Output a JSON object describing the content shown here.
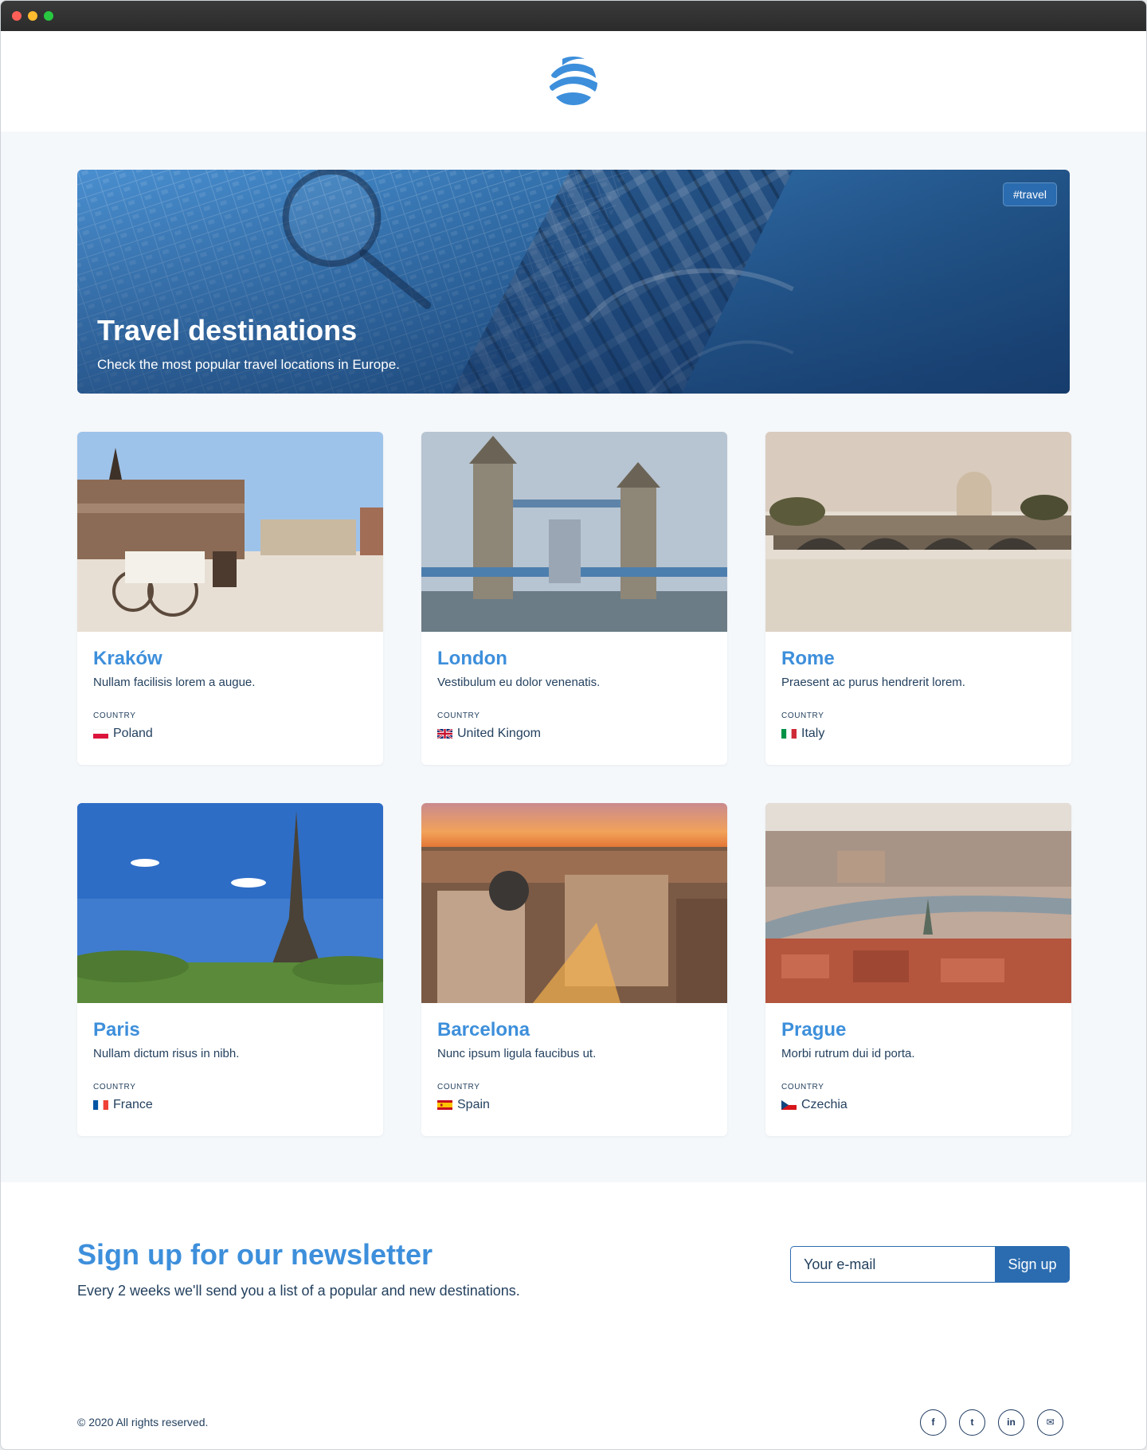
{
  "window": {
    "controls": [
      "close",
      "minimize",
      "maximize"
    ],
    "colors": {
      "close": "#ff5f57",
      "minimize": "#febc2e",
      "maximize": "#28c840"
    }
  },
  "header": {
    "logo_icon": "wave-globe-icon"
  },
  "hero": {
    "tag": "#travel",
    "title": "Travel destinations",
    "subtitle": "Check the most popular travel locations in Europe."
  },
  "cards": [
    {
      "city": "Kraków",
      "description": "Nullam facilisis lorem a augue.",
      "country_label": "COUNTRY",
      "country": "Poland",
      "flag": "pl"
    },
    {
      "city": "London",
      "description": "Vestibulum eu dolor venenatis.",
      "country_label": "COUNTRY",
      "country": "United Kingom",
      "flag": "gb"
    },
    {
      "city": "Rome",
      "description": "Praesent ac purus hendrerit lorem.",
      "country_label": "COUNTRY",
      "country": "Italy",
      "flag": "it"
    },
    {
      "city": "Paris",
      "description": "Nullam dictum risus in nibh.",
      "country_label": "COUNTRY",
      "country": "France",
      "flag": "fr"
    },
    {
      "city": "Barcelona",
      "description": "Nunc ipsum ligula faucibus ut.",
      "country_label": "COUNTRY",
      "country": "Spain",
      "flag": "es"
    },
    {
      "city": "Prague",
      "description": "Morbi rutrum dui id porta.",
      "country_label": "COUNTRY",
      "country": "Czechia",
      "flag": "cz"
    }
  ],
  "newsletter": {
    "title": "Sign up for our newsletter",
    "subtitle": "Every 2 weeks we'll send you a list of a popular and new destinations.",
    "input_placeholder": "Your e-mail",
    "button_label": "Sign up"
  },
  "footer": {
    "copyright": "© 2020 All rights reserved.",
    "socials": [
      {
        "icon": "facebook-icon",
        "glyph": "f"
      },
      {
        "icon": "twitter-icon",
        "glyph": "t"
      },
      {
        "icon": "linkedin-icon",
        "glyph": "in"
      },
      {
        "icon": "email-icon",
        "glyph": "✉"
      }
    ]
  },
  "colors": {
    "accent": "#3d8fdb",
    "primary": "#2b6cb0",
    "text": "#24415f"
  }
}
